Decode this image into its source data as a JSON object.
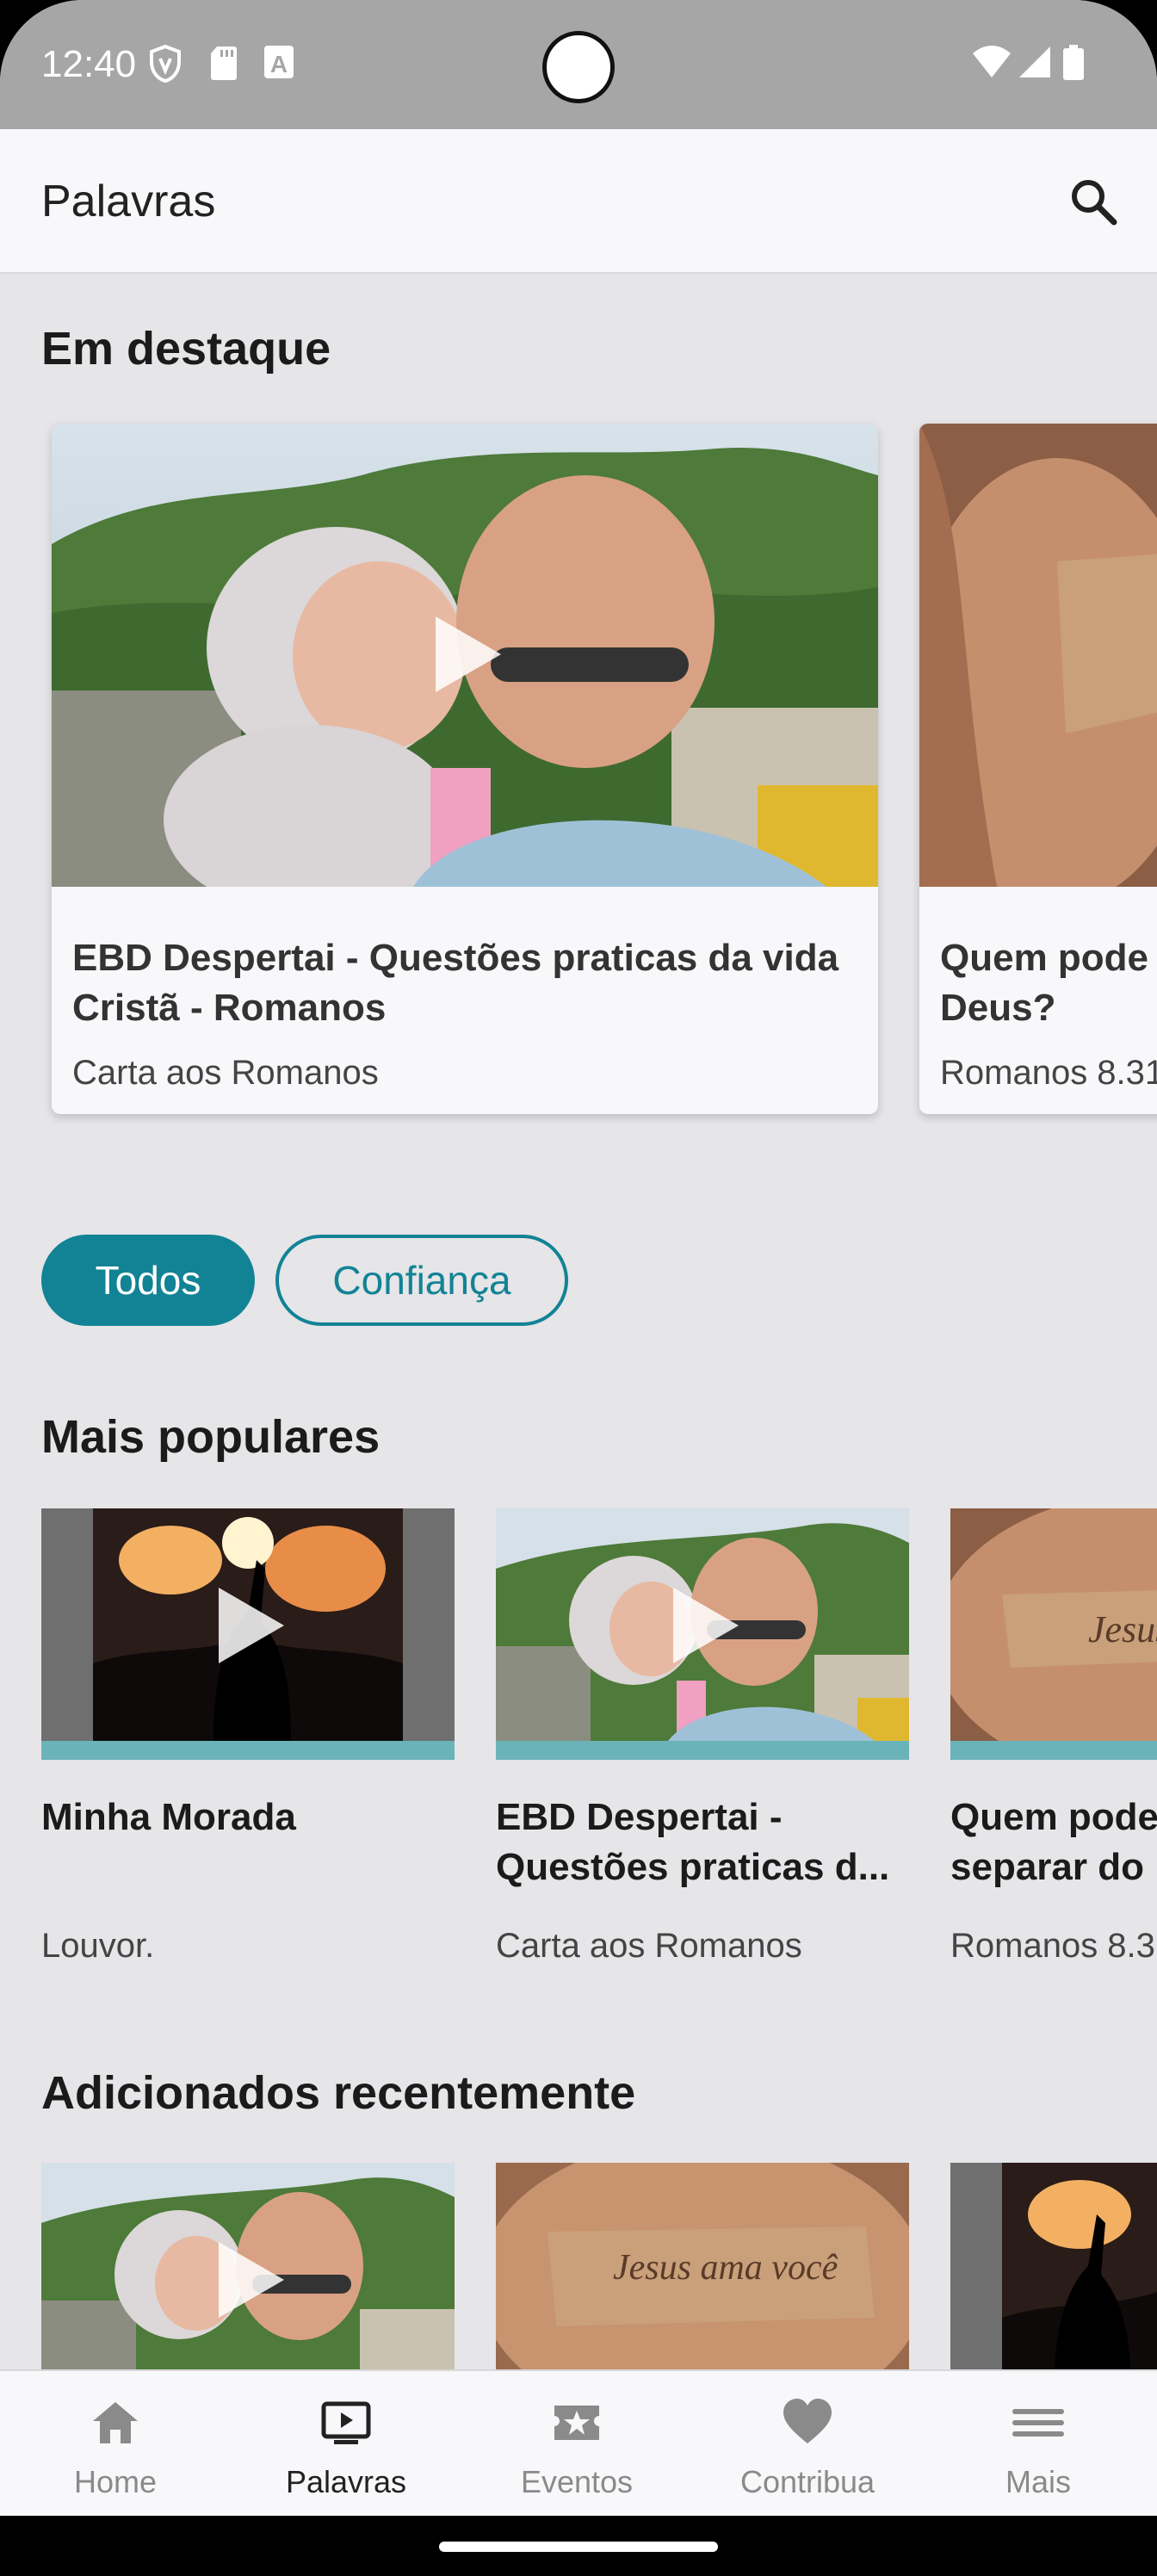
{
  "status_bar": {
    "time": "12:40",
    "icons": [
      "shield-icon",
      "sd-card-icon",
      "a-box-icon",
      "wifi-icon",
      "cellular-signal-icon",
      "battery-icon"
    ]
  },
  "app_bar": {
    "title": "Palavras",
    "search_icon": "search-icon"
  },
  "featured": {
    "title": "Em destaque",
    "cards": [
      {
        "title": "EBD Despertai - Questões praticas da vida\nCristã - Romanos",
        "subtitle": "Carta aos Romanos",
        "image": "family-selfie-photo"
      },
      {
        "title": "Quem pode\nDeus?",
        "subtitle": "Romanos 8.31",
        "image": "hands-jesus-paper-photo"
      }
    ]
  },
  "filters": {
    "chips": [
      "Todos",
      "Confiança"
    ],
    "selected": "Todos"
  },
  "popular": {
    "title": "Mais populares",
    "items": [
      {
        "title": "Minha Morada",
        "subtitle": "Louvor.",
        "image": "worship-concert-photo"
      },
      {
        "title": "EBD Despertai -\nQuestões praticas d...",
        "subtitle": "Carta aos Romanos",
        "image": "family-selfie-photo"
      },
      {
        "title": "Quem pode\nseparar do",
        "subtitle": "Romanos 8.3",
        "image": "hands-jesus-paper-photo"
      }
    ]
  },
  "recent": {
    "title": "Adicionados recentemente",
    "items": [
      {
        "image": "family-selfie-photo"
      },
      {
        "image": "hands-jesus-paper-photo",
        "overlay_text": "Jesus ama você"
      },
      {
        "image": "worship-concert-photo"
      }
    ]
  },
  "bottom_nav": {
    "items": [
      {
        "label": "Home",
        "icon": "home-icon"
      },
      {
        "label": "Palavras",
        "icon": "tv-play-icon"
      },
      {
        "label": "Eventos",
        "icon": "star-ticket-icon"
      },
      {
        "label": "Contribua",
        "icon": "heart-icon"
      },
      {
        "label": "Mais",
        "icon": "menu-icon"
      }
    ],
    "active": "Palavras"
  },
  "colors": {
    "accent": "#128395",
    "background": "#e6e5e8",
    "bar_accent": "#6ab3b8"
  }
}
